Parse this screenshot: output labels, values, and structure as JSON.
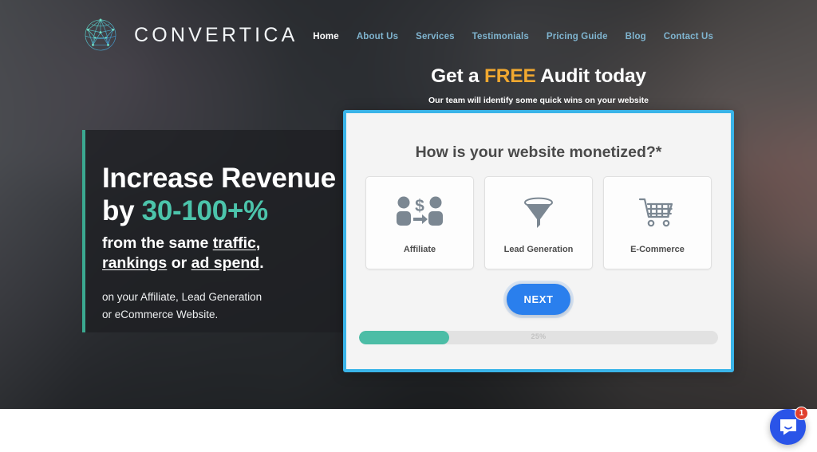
{
  "header": {
    "brand_name": "CONVERTICA",
    "logo_icon": "network-sphere-icon",
    "nav": [
      {
        "label": "Home",
        "active": true
      },
      {
        "label": "About Us",
        "active": false
      },
      {
        "label": "Services",
        "active": false
      },
      {
        "label": "Testimonials",
        "active": false
      },
      {
        "label": "Pricing Guide",
        "active": false
      },
      {
        "label": "Blog",
        "active": false
      },
      {
        "label": "Contact Us",
        "active": false
      }
    ]
  },
  "audit": {
    "title_before": "Get a ",
    "title_highlight": "FREE",
    "title_after": " Audit today",
    "subtitle": "Our team will identify some quick wins on your website"
  },
  "promo": {
    "heading_line1": "Increase Revenue",
    "heading_line2_prefix": "by ",
    "heading_line2_pct": "30-100+%",
    "sub_line1_a": "from the same ",
    "sub_line1_u": "traffic",
    "sub_line1_b": ",",
    "sub_line2_u1": "rankings",
    "sub_line2_mid": " or ",
    "sub_line2_u2": "ad spend",
    "sub_line2_end": ".",
    "body_line1": "on your Affiliate, Lead Generation",
    "body_line2": "or eCommerce Website."
  },
  "form": {
    "question": "How is your website monetized?*",
    "options": [
      {
        "label": "Affiliate",
        "icon": "affiliate-people-dollar-icon"
      },
      {
        "label": "Lead Generation",
        "icon": "funnel-icon"
      },
      {
        "label": "E-Commerce",
        "icon": "shopping-cart-icon"
      }
    ],
    "next_label": "NEXT",
    "progress": {
      "percent": 25,
      "label": "25%"
    }
  },
  "chat": {
    "icon": "chat-bubble-icon",
    "unread_count": "1"
  },
  "colors": {
    "card_border": "#3ab4e8",
    "accent_teal": "#4cc4ab",
    "panel_accent": "#3ba890",
    "free_orange": "#f0a830",
    "next_blue": "#2a7fed",
    "progress_fill": "#4cbda6",
    "nav_link": "#7fb4cf",
    "badge_red": "#e0402e"
  }
}
